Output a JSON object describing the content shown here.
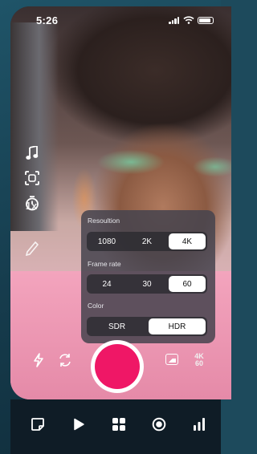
{
  "status_bar": {
    "time": "5:26"
  },
  "side_toolbar": [
    "music-note-icon",
    "face-frame-icon",
    "timer-icon",
    "speed-icon",
    "filter-icon"
  ],
  "settings_panel": {
    "resolution": {
      "label": "Resoultion",
      "options": [
        "1080",
        "2K",
        "4K"
      ],
      "selected": "4K"
    },
    "frame_rate": {
      "label": "Frame rate",
      "options": [
        "24",
        "30",
        "60"
      ],
      "selected": "60"
    },
    "color": {
      "label": "Color",
      "options": [
        "SDR",
        "HDR"
      ],
      "selected": "HDR"
    }
  },
  "camera_controls": {
    "resolution_badge_top": "4K",
    "resolution_badge_bottom": "60",
    "shutter_color": "#ef1766"
  },
  "bottom_nav": [
    "sticker-icon",
    "play-icon",
    "grid-icon",
    "record-icon",
    "stats-icon"
  ]
}
